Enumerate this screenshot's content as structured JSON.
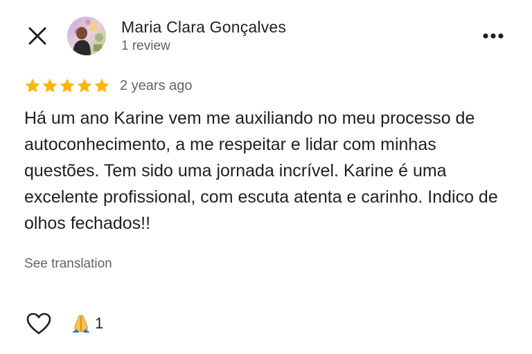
{
  "review": {
    "author_name": "Maria Clara Gonçalves",
    "review_count": "1 review",
    "rating": 5,
    "max_rating": 5,
    "time_ago": "2 years ago",
    "text": "Há um ano Karine vem me auxiliando no meu processo de autoconhecimento, a me respeitar e lidar com minhas questões. Tem sido uma jornada incrível. Karine é uma excelente profissional, com escuta atenta e carinho. Indico de olhos fechados!!",
    "see_translation_label": "See translation"
  },
  "reactions": {
    "emoji": "🙏",
    "count": "1"
  },
  "icons": {
    "close": "close-icon",
    "more": "more-horizontal-icon",
    "star": "star-icon",
    "like": "heart-outline-icon",
    "reaction": "folded-hands-emoji"
  },
  "colors": {
    "star": "#F9B701",
    "secondary_text": "#5f6368",
    "primary_text": "#1f1f1f"
  }
}
